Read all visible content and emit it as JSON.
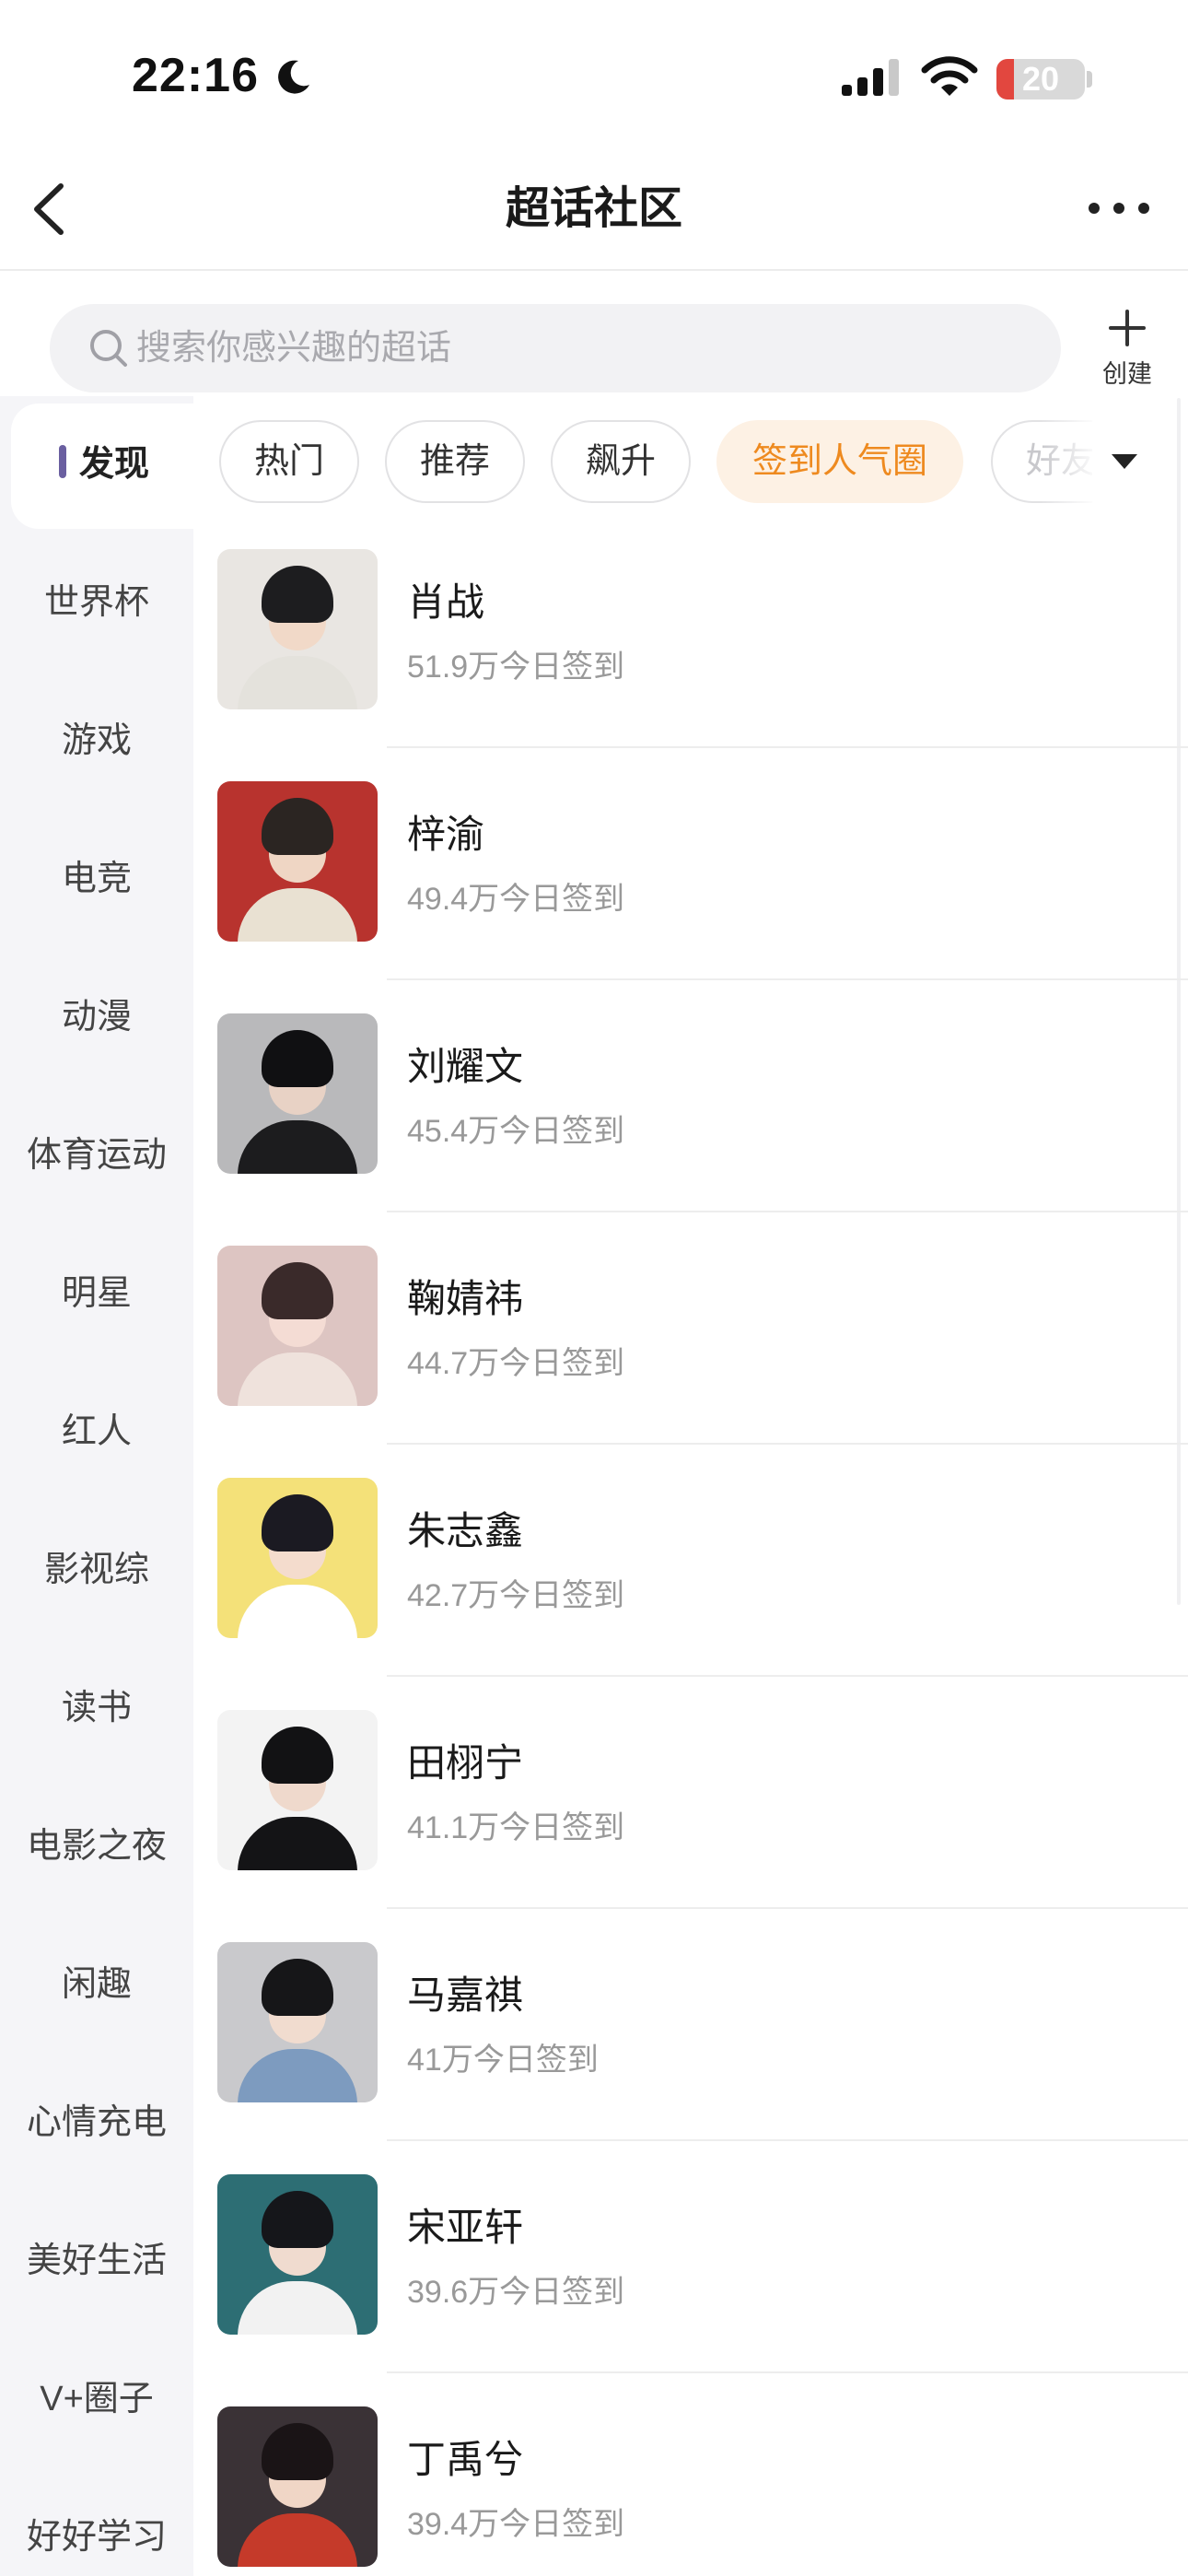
{
  "status_bar": {
    "time": "22:16",
    "battery_level": "20",
    "battery_fraction": 0.2,
    "battery_color": "#e2473f",
    "icons": [
      "moon-icon",
      "signal-icon",
      "wifi-icon",
      "battery-icon"
    ]
  },
  "nav": {
    "title": "超话社区",
    "back_icon": "chevron-left-icon",
    "more_icon": "more-horizontal-icon"
  },
  "search": {
    "placeholder": "搜索你感兴趣的超话",
    "value": ""
  },
  "create": {
    "label": "创建",
    "icon": "plus-icon"
  },
  "sidebar": {
    "active_label": "发现",
    "items": [
      "世界杯",
      "游戏",
      "电竞",
      "动漫",
      "体育运动",
      "明星",
      "红人",
      "影视综",
      "读书",
      "电影之夜",
      "闲趣",
      "心情充电",
      "美好生活",
      "V+圈子",
      "好好学习"
    ]
  },
  "tabs": {
    "items": [
      "热门",
      "推荐",
      "飙升",
      "签到人气圈"
    ],
    "active": "签到人气圈",
    "partial": "好友",
    "active_color": "#ee8a1f"
  },
  "list": [
    {
      "name": "肖战",
      "stat": "51.9万今日签到"
    },
    {
      "name": "梓渝",
      "stat": "49.4万今日签到"
    },
    {
      "name": "刘耀文",
      "stat": "45.4万今日签到"
    },
    {
      "name": "鞠婧祎",
      "stat": "44.7万今日签到"
    },
    {
      "name": "朱志鑫",
      "stat": "42.7万今日签到"
    },
    {
      "name": "田栩宁",
      "stat": "41.1万今日签到"
    },
    {
      "name": "马嘉祺",
      "stat": "41万今日签到"
    },
    {
      "name": "宋亚轩",
      "stat": "39.6万今日签到"
    },
    {
      "name": "丁禹兮",
      "stat": "39.4万今日签到"
    }
  ]
}
